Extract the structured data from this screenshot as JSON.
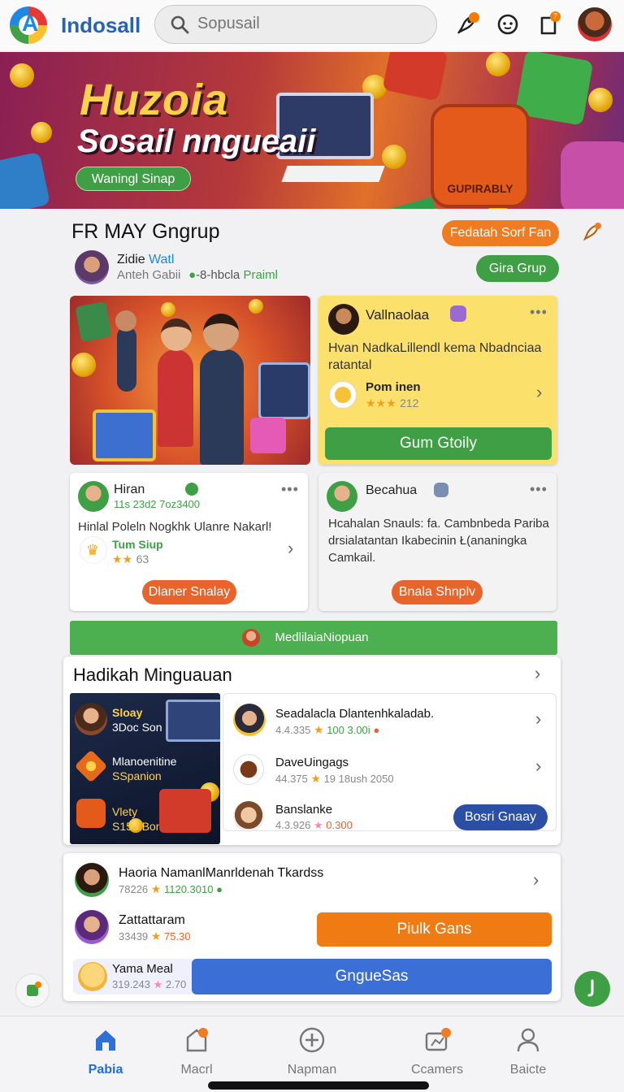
{
  "header": {
    "app_title": "Indosall",
    "search_placeholder": "Sopusail",
    "badges": {
      "rocket": "",
      "messages": "7"
    }
  },
  "banner": {
    "title": "Huzoia",
    "subtitle": "Sosail nngueaii",
    "cta": "Waningl Sinap",
    "jar_label": "GUPIRABLY"
  },
  "group": {
    "title": "FR MAY Gngrup",
    "feature_button": "Fedatah Sorf Fan",
    "join_button": "Gira Grup",
    "member": {
      "name": "Zidie",
      "handle": "Watl",
      "meta": "Anteh Gabii",
      "points_prefix": "-8-hbcla",
      "points": "Praiml"
    }
  },
  "posts": {
    "yellow": {
      "author": "Vallnaolaa",
      "text": "Hvan NadkaLillendl kema Nbadnciaa ratantal",
      "sub_name": "Pom inen",
      "sub_rating": "212",
      "cta": "Gum Gtoily"
    },
    "hiran": {
      "author": "Hiran",
      "meta": "11s 23d2 7oz3400",
      "text": "Hinlal Poleln Nogkhk Ulanre Nakarl!",
      "sub_name": "Tum Siup",
      "sub_rating": "63",
      "cta": "Dlaner Snalay"
    },
    "becahua": {
      "author": "Becahua",
      "text": "Hcahalan Snauls: fa. Cambnbeda Pariba drsialatantan Ikabecinin Ł(ananingka Camkail.",
      "cta": "Bnala Shnplv"
    }
  },
  "strip": {
    "label": "MedlilaiaNiopuan"
  },
  "section": {
    "title": "Hadikah Minguauan",
    "panel": [
      {
        "name": "Sloay",
        "sub": "3Doc Son"
      },
      {
        "name": "Mlanoenitine",
        "sub": "SSpanion"
      },
      {
        "name": "Vlety",
        "sub": "S155.Bon"
      }
    ],
    "list": [
      {
        "name": "Seadalacla Dlantenhkaladab.",
        "meta_a": "4.4.335",
        "meta_b": "100 3.00i"
      },
      {
        "name": "DaveUingags",
        "meta_a": "44.375",
        "meta_b": "19 18ush 2050"
      },
      {
        "name": "Banslanke",
        "meta_a": "4.3.926",
        "meta_b": "0.300"
      }
    ],
    "boost_button": "Bosri Gnaay"
  },
  "section2": {
    "rows": [
      {
        "name": "Haoria NamanlManrldenah Tkardss",
        "meta_a": "78226",
        "meta_b": "1120.3010"
      },
      {
        "name": "Zattattaram",
        "meta_a": "33439",
        "meta_b": "75.30"
      },
      {
        "name": "Yama Meal",
        "meta_a": "319.243",
        "meta_b": "2.70"
      }
    ],
    "publish_button": "Piulk Gans",
    "blue_button": "GngueSas"
  },
  "nav": [
    {
      "label": "Pabia",
      "icon": "home-icon"
    },
    {
      "label": "Macrl",
      "icon": "bag-icon"
    },
    {
      "label": "Napman",
      "icon": "plus-icon"
    },
    {
      "label": "Ccamers",
      "icon": "camera-icon"
    },
    {
      "label": "Baicte",
      "icon": "profile-icon"
    }
  ],
  "colors": {
    "brand_blue": "#2563b8",
    "green": "#3e9f45",
    "orange": "#f07b21",
    "yellow_card": "#fbe06b"
  }
}
